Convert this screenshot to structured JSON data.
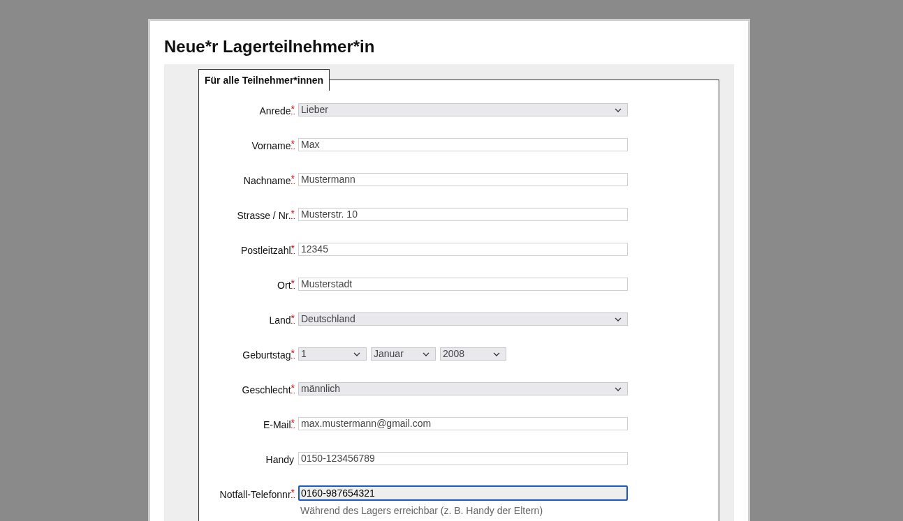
{
  "title": "Neue*r Lagerteilnehmer*in",
  "fieldset": {
    "legend": "Für alle Teilnehmer*innen",
    "required_mark": "*",
    "fields": [
      {
        "kind": "select",
        "label": "Anrede",
        "required": true,
        "value": "Lieber",
        "focused": false
      },
      {
        "kind": "text",
        "label": "Vorname",
        "required": true,
        "value": "Max",
        "focused": false
      },
      {
        "kind": "text",
        "label": "Nachname",
        "required": true,
        "value": "Mustermann",
        "focused": false
      },
      {
        "kind": "text",
        "label": "Strasse / Nr.",
        "required": true,
        "value": "Musterstr. 10",
        "focused": false
      },
      {
        "kind": "text",
        "label": "Postleitzahl",
        "required": true,
        "value": "12345",
        "focused": false
      },
      {
        "kind": "text",
        "label": "Ort",
        "required": true,
        "value": "Musterstadt",
        "focused": false
      },
      {
        "kind": "select",
        "label": "Land",
        "required": true,
        "value": "Deutschland",
        "focused": false
      },
      {
        "kind": "date",
        "label": "Geburtstag",
        "required": true,
        "parts": [
          "1",
          "Januar",
          "2008"
        ],
        "focused": false
      },
      {
        "kind": "select",
        "label": "Geschlecht",
        "required": true,
        "value": "männlich",
        "focused": false
      },
      {
        "kind": "text",
        "label": "E-Mail",
        "required": true,
        "value": "max.mustermann@gmail.com",
        "focused": false
      },
      {
        "kind": "text",
        "label": "Handy",
        "required": false,
        "value": "0150-123456789",
        "focused": false
      },
      {
        "kind": "text",
        "label": "Notfall-Telefonnr",
        "required": true,
        "value": "0160-987654321",
        "focused": true,
        "hint": "Während des Lagers erreichbar (z. B. Handy der Eltern)"
      }
    ]
  }
}
